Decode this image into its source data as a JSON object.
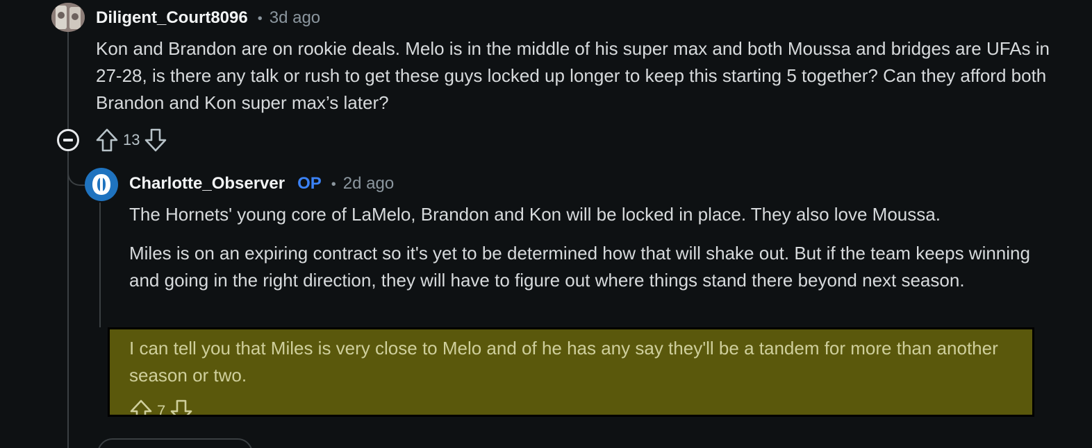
{
  "comment_1": {
    "username": "Diligent_Court8096",
    "separator": "•",
    "time": "3d ago",
    "body": "Kon and Brandon are on rookie deals. Melo is in the middle of his super max and both Moussa and bridges are UFAs in 27-28, is there any talk or rush to get these guys locked up longer to keep this starting 5 together? Can they afford both Brandon and Kon super max’s later?",
    "score": "13"
  },
  "comment_2": {
    "username": "Charlotte_Observer",
    "badge": "OP",
    "separator": "•",
    "time": "2d ago",
    "paragraphs": [
      "The Hornets' young core of LaMelo, Brandon and Kon will be locked in place. They also love Moussa.",
      "Miles is on an expiring contract so it's yet to be determined how that will shake out. But if the team keeps winning and going in the right direction, they will have to figure out where things stand there beyond next season.",
      "I can tell you that Miles is very close to Melo and of he has any say they'll be a tandem for more than another season or two."
    ],
    "score": "7"
  },
  "colors": {
    "background": "#0e1113",
    "highlight": "#5a580c",
    "op_badge": "#3b82f6",
    "avatar_blue": "#1f73bf"
  },
  "icons": {
    "upvote": "arrow-up-outline-icon",
    "downvote": "arrow-down-outline-icon",
    "collapse": "minus-circle-icon"
  }
}
